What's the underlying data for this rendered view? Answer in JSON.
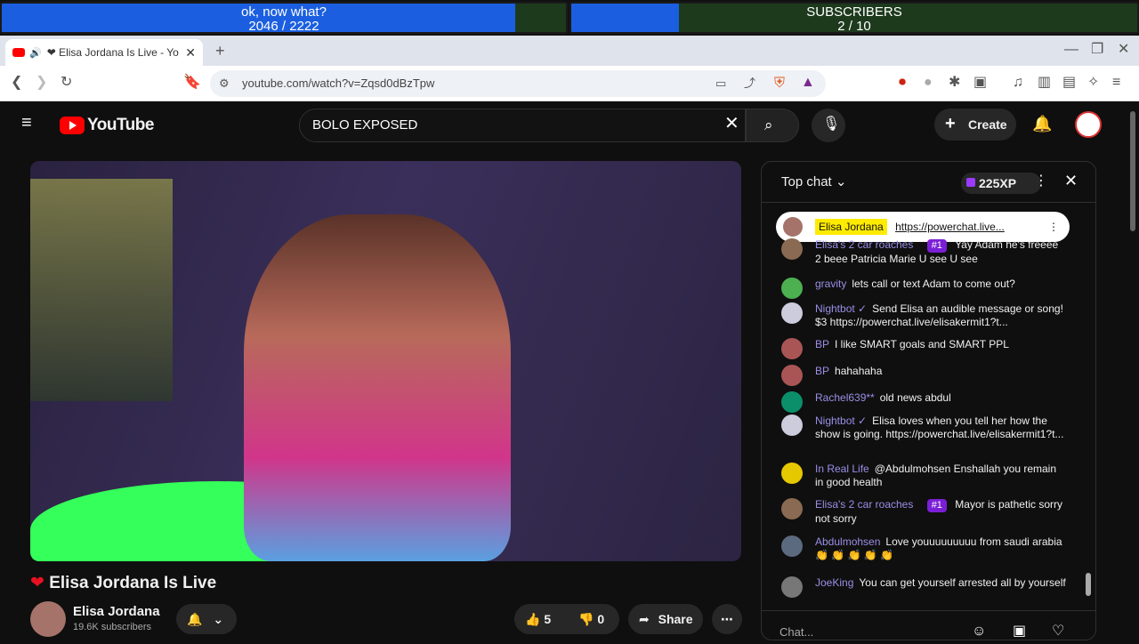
{
  "overlay": {
    "left": {
      "title": "ok, now what?",
      "count": "2046  /  2222",
      "progress": 0.92
    },
    "right": {
      "title": "SUBSCRIBERS",
      "count": "2  /  10",
      "progress": 0.2
    }
  },
  "browser": {
    "tab_title": "❤ Elisa Jordana Is Live - Yo",
    "new_tab": "+",
    "url": "youtube.com/watch?v=Zqsd0dBzTpw"
  },
  "youtube": {
    "logo": "YouTube",
    "search_value": "BOLO EXPOSED",
    "create_label": "Create",
    "video_title": "Elisa Jordana Is Live",
    "heart_icon": "heart-icon",
    "channel_name": "Elisa Jordana",
    "subscribers": "19.6K subscribers",
    "likes": "5",
    "dislikes": "0",
    "share_label": "Share"
  },
  "chat": {
    "mode": "Top chat",
    "xp": "225XP",
    "pinned": {
      "author": "Elisa Jordana",
      "text": "https://powerchat.live..."
    },
    "messages": [
      {
        "author": "Elisa's 2 car roaches",
        "badge": "#1",
        "text": "Yay Adam he's freeee 2 beee Patricia Marie U see U see",
        "color": "#8a6a52"
      },
      {
        "author": "gravity",
        "badge": "",
        "text": "lets call or text Adam to come out?",
        "color": "#4caf50"
      },
      {
        "author": "Nightbot ✓",
        "badge": "",
        "text": "Send Elisa an audible message or song! $3 https://powerchat.live/elisakermit1?t...",
        "color": "#ccd"
      },
      {
        "author": "BP",
        "badge": "",
        "text": "I like SMART goals and SMART PPL",
        "color": "#a55"
      },
      {
        "author": "BP",
        "badge": "",
        "text": "hahahaha",
        "color": "#a55"
      },
      {
        "author": "Rachel639**",
        "badge": "",
        "text": "old news abdul",
        "color": "#0b8f6a"
      },
      {
        "author": "Nightbot ✓",
        "badge": "",
        "text": "Elisa loves when you tell her how the show is going. https://powerchat.live/elisakermit1?t...",
        "color": "#ccd"
      },
      {
        "author": "In Real Life",
        "badge": "",
        "text": "@Abdulmohsen Enshallah you remain in good health",
        "color": "#e6c800"
      },
      {
        "author": "Elisa's 2 car roaches",
        "badge": "#1",
        "text": "Mayor is pathetic sorry not sorry",
        "color": "#8a6a52"
      },
      {
        "author": "Abdulmohsen",
        "badge": "",
        "text": "Love youuuuuuuuu from saudi arabia 👏 👏 👏 👏 👏",
        "color": "#5c6a80"
      },
      {
        "author": "JoeKing",
        "badge": "",
        "text": "You can get yourself arrested all by yourself",
        "color": "#777"
      }
    ],
    "input_placeholder": "Chat..."
  }
}
